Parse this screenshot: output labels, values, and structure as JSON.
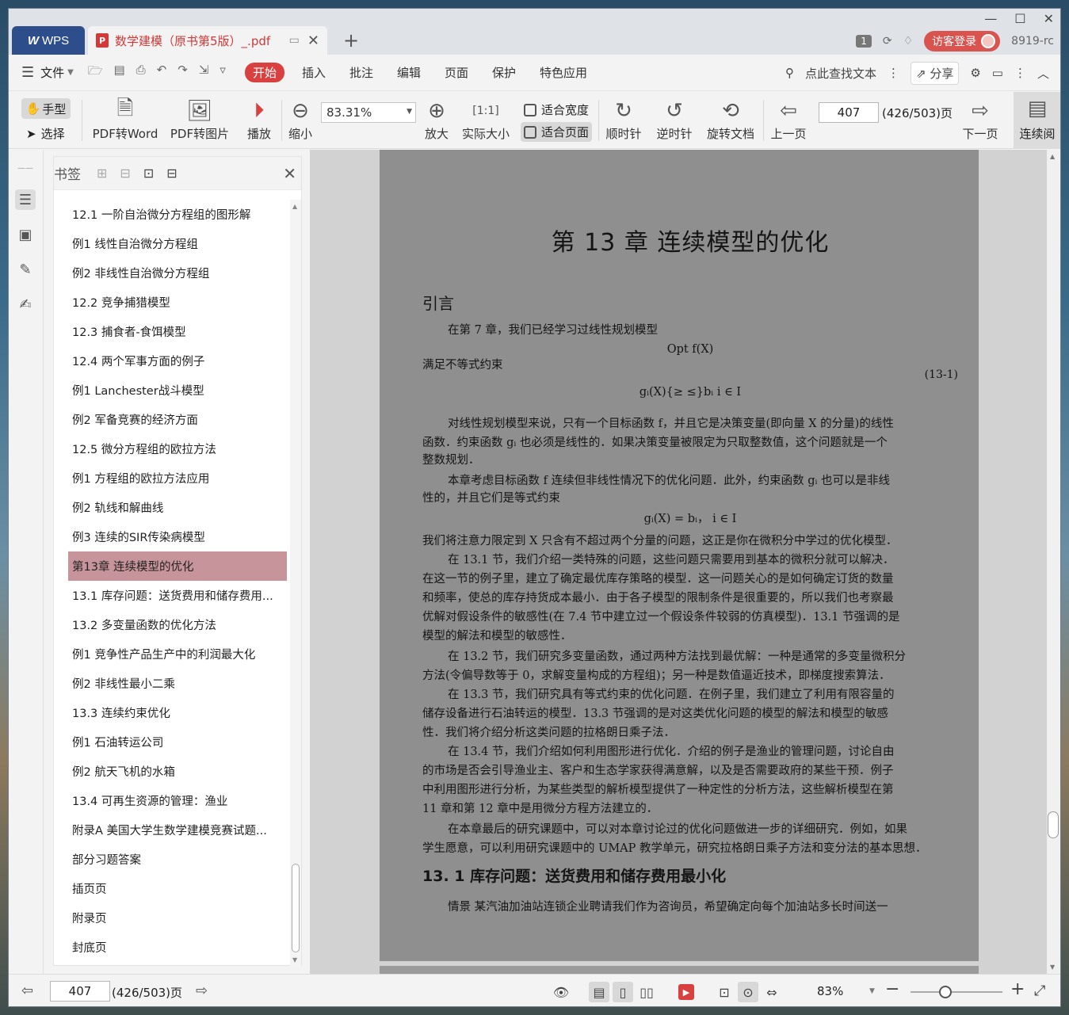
{
  "titlebar": {
    "wps_tab": "WPS",
    "doc_tab": "数学建模（原书第5版）_.pdf",
    "window_count": "1",
    "login": "访客登录",
    "user_code": "8919-rc"
  },
  "menu": {
    "file": "文件",
    "tabs": [
      "开始",
      "插入",
      "批注",
      "编辑",
      "页面",
      "保护",
      "特色应用"
    ],
    "search": "点此查找文本",
    "share": "分享"
  },
  "toolbar": {
    "hand": "手型",
    "select": "选择",
    "pdf_to_word": "PDF转Word",
    "pdf_to_image": "PDF转图片",
    "play": "播放",
    "zoom_out": "缩小",
    "zoom_value": "83.31%",
    "zoom_in": "放大",
    "actual_size": "实际大小",
    "fit_width": "适合宽度",
    "fit_page": "适合页面",
    "clockwise": "顺时针",
    "counter_clockwise": "逆时针",
    "rotate_doc": "旋转文档",
    "prev_page": "上一页",
    "page_input": "407",
    "page_of": "(426/503)页",
    "next_page": "下一页",
    "continuous": "连续阅"
  },
  "panel": {
    "title": "书签",
    "items": [
      "12.1  一阶自治微分方程组的图形解",
      "例1  线性自治微分方程组",
      "例2  非线性自治微分方程组",
      "12.2  竞争捕猎模型",
      "12.3  捕食者-食饵模型",
      "12.4  两个军事方面的例子",
      "例1  Lanchester战斗模型",
      "例2  军备竞赛的经济方面",
      "12.5  微分方程组的欧拉方法",
      "例1  方程组的欧拉方法应用",
      "例2  轨线和解曲线",
      "例3  连续的SIR传染病模型",
      "第13章  连续模型的优化",
      "13.1  库存问题：送货费用和储存费用...",
      "13.2  多变量函数的优化方法",
      "例1  竞争性产品生产中的利润最大化",
      "例2  非线性最小二乘",
      "13.3  连续约束优化",
      "例1  石油转运公司",
      "例2  航天飞机的水箱",
      "13.4  可再生资源的管理：渔业",
      "附录A  美国大学生数学建模竞赛试题...",
      "部分习题答案",
      "插页页",
      "附录页",
      "封底页"
    ],
    "selected_index": 12
  },
  "page": {
    "chapter_title": "第 13 章    连续模型的优化",
    "intro_heading": "引言",
    "lines": [
      "在第 7 章，我们已经学习过线性规划模型",
      "Opt  f(X)",
      "满足不等式约束",
      "(13-1)",
      "gᵢ(X){≥ ≤}bᵢ    i ∈ I",
      "对线性规划模型来说，只有一个目标函数 f，并且它是决策变量(即向量 X 的分量)的线性",
      "函数．约束函数 gᵢ 也必须是线性的．如果决策变量被限定为只取整数值，这个问题就是一个",
      "整数规划．",
      "本章考虑目标函数 f 连续但非线性情况下的优化问题．此外，约束函数 gᵢ 也可以是非线",
      "性的，并且它们是等式约束",
      "gᵢ(X) = bᵢ，  i ∈ I",
      "我们将注意力限定到 X 只含有不超过两个分量的问题，这正是你在微积分中学过的优化模型．",
      "在 13.1 节，我们介绍一类特殊的问题，这些问题只需要用到基本的微积分就可以解决．",
      "在这一节的例子里，建立了确定最优库存策略的模型．这一问题关心的是如何确定订货的数量",
      "和频率，使总的库存持货成本最小．由于各子模型的限制条件是很重要的，所以我们也考察最",
      "优解对假设条件的敏感性(在 7.4 节中建立过一个假设条件较弱的仿真模型)．13.1 节强调的是",
      "模型的解法和模型的敏感性．",
      "在 13.2 节，我们研究多变量函数，通过两种方法找到最优解：一种是通常的多变量微积分",
      "方法(令偏导数等于 0，求解变量构成的方程组)；另一种是数值逼近技术，即梯度搜索算法．",
      "在 13.3 节，我们研究具有等式约束的优化问题．在例子里，我们建立了利用有限容量的",
      "储存设备进行石油转运的模型．13.3 节强调的是对这类优化问题的模型的解法和模型的敏感",
      "性．我们将介绍分析这类问题的拉格朗日乘子法．",
      "在 13.4 节，我们介绍如何利用图形进行优化．介绍的例子是渔业的管理问题，讨论自由",
      "的市场是否会引导渔业主、客户和生态学家获得满意解，以及是否需要政府的某些干预．例子",
      "中利用图形进行分析，为某些类型的解析模型提供了一种定性的分析方法，这些解析模型在第",
      "11 章和第 12 章中是用微分方程方法建立的．",
      "在本章最后的研究课题中，可以对本章讨论过的优化问题做进一步的详细研究．例如，如果",
      "学生愿意，可以利用研究课题中的 UMAP 教学单元，研究拉格朗日乘子方法和变分法的基本思想．"
    ],
    "section_heading": "13. 1    库存问题：送货费用和储存费用最小化",
    "last_line": "情景    某汽油加油站连锁企业聘请我们作为咨询员，希望确定向每个加油站多长时间送一"
  },
  "statusbar": {
    "page_input": "407",
    "page_of": "(426/503)页",
    "zoom": "83%"
  }
}
